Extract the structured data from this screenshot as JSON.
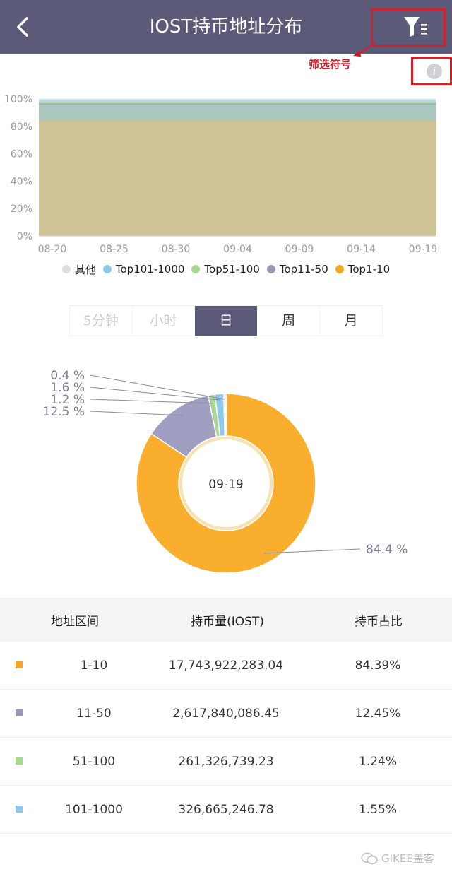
{
  "header": {
    "title": "IOST持币地址分布"
  },
  "annotation": {
    "filter_label": "筛选符号"
  },
  "info_icon_glyph": "i",
  "area_chart": {
    "type": "area",
    "y_ticks": [
      "100%",
      "80%",
      "60%",
      "40%",
      "20%",
      "0%"
    ],
    "x_ticks": [
      "08-20",
      "08-25",
      "08-30",
      "09-04",
      "09-09",
      "09-14",
      "09-19"
    ],
    "ylim": [
      0,
      100
    ],
    "series": [
      {
        "name": "Top1-10",
        "color": "#cdc396",
        "top": 84.4
      },
      {
        "name": "Top11-50",
        "color": "#a9c7bd",
        "top": 96.9
      },
      {
        "name": "Top51-100",
        "color": "#b9dcb7",
        "top": 98.1
      },
      {
        "name": "Top101-1000",
        "color": "#b7dbe8",
        "top": 99.6
      },
      {
        "name": "其他",
        "color": "#e6e6e6",
        "top": 100
      }
    ]
  },
  "legend": [
    {
      "label": "其他",
      "color": "#dedede"
    },
    {
      "label": "Top101-1000",
      "color": "#8ec9ec"
    },
    {
      "label": "Top51-100",
      "color": "#a8d88f"
    },
    {
      "label": "Top11-50",
      "color": "#9a99b5"
    },
    {
      "label": "Top1-10",
      "color": "#f5a623"
    }
  ],
  "tabs": [
    {
      "label": "5分钟",
      "state": "disabled"
    },
    {
      "label": "小时",
      "state": "disabled"
    },
    {
      "label": "日",
      "state": "active"
    },
    {
      "label": "周",
      "state": "normal"
    },
    {
      "label": "月",
      "state": "normal"
    }
  ],
  "chart_data": {
    "type": "pie",
    "center_label": "09-19",
    "slices": [
      {
        "name": "Top1-10",
        "value": 84.4,
        "label": "84.4 %",
        "color": "#f9ae2d"
      },
      {
        "name": "Top11-50",
        "value": 12.5,
        "label": "12.5 %",
        "color": "#a09fc2"
      },
      {
        "name": "Top51-100",
        "value": 1.2,
        "label": "1.2 %",
        "color": "#a8d88f"
      },
      {
        "name": "Top101-1000",
        "value": 1.6,
        "label": "1.6 %",
        "color": "#8ec9ec"
      },
      {
        "name": "其他",
        "value": 0.4,
        "label": "0.4 %",
        "color": "#e8e8e8"
      }
    ]
  },
  "table": {
    "headers": [
      "地址区间",
      "持币量(IOST)",
      "持币占比"
    ],
    "rows": [
      {
        "range": "1-10",
        "amount": "17,743,922,283.04",
        "pct": "84.39%",
        "color": "#f5a623"
      },
      {
        "range": "11-50",
        "amount": "2,617,840,086.45",
        "pct": "12.45%",
        "color": "#9a99b5"
      },
      {
        "range": "51-100",
        "amount": "261,326,739.23",
        "pct": "1.24%",
        "color": "#a8d88f"
      },
      {
        "range": "101-1000",
        "amount": "326,665,246.78",
        "pct": "1.55%",
        "color": "#8ec9ec"
      }
    ]
  },
  "watermark": {
    "text": "GIKEE盖客"
  }
}
